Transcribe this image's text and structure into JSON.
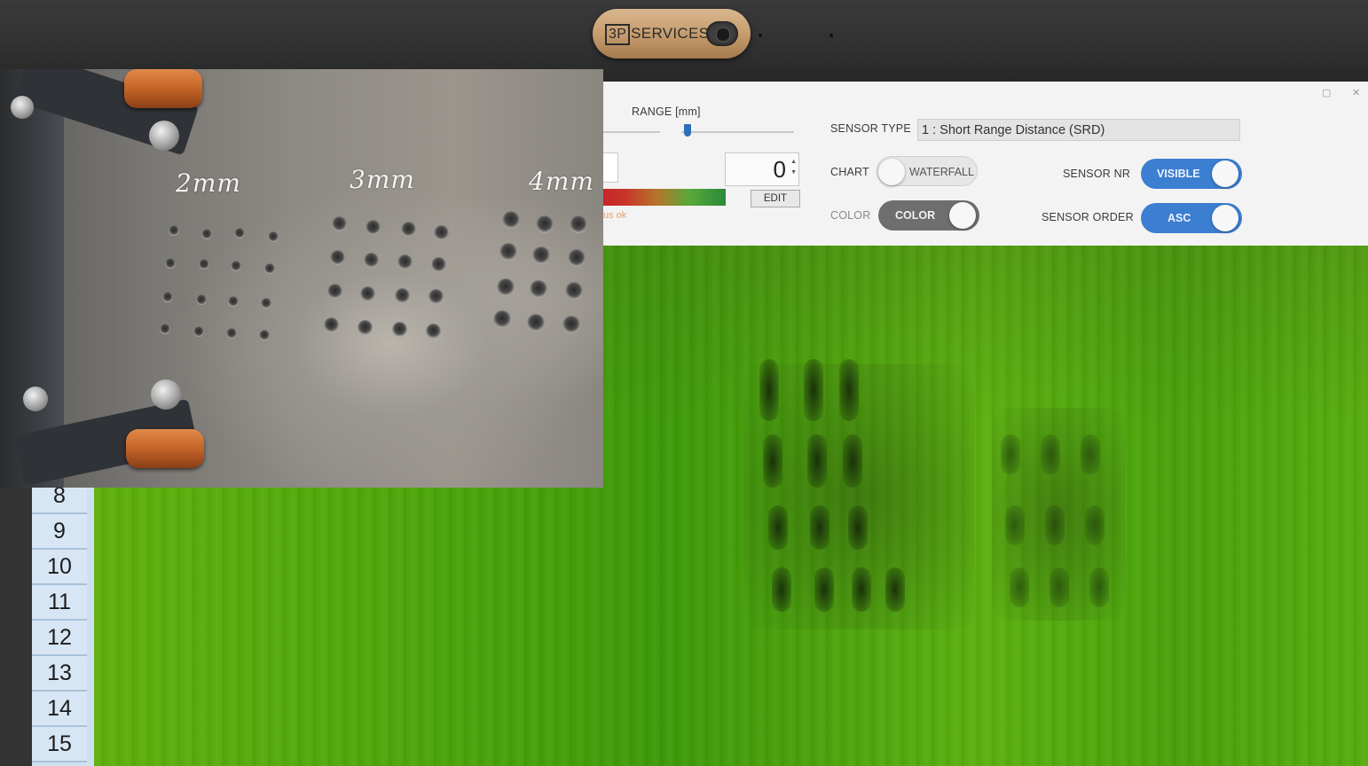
{
  "bezel": {
    "webcam_cover_brand_box": "3P",
    "webcam_cover_brand_text": "SERVICES"
  },
  "toolbar": {
    "range_label": "RANGE [mm]",
    "spin_value": "0",
    "edit_label": "EDIT",
    "status_partial": "us  ok",
    "sensor_type_label": "SENSOR TYPE",
    "sensor_type_value": "1 : Short Range Distance (SRD)",
    "chart_label": "CHART",
    "chart_toggle_text": "WATERFALL",
    "color_label": "COLOR",
    "color_toggle_text": "COLOR",
    "sensor_nr_label": "SENSOR NR",
    "sensor_nr_toggle_text": "VISIBLE",
    "sensor_order_label": "SENSOR ORDER",
    "sensor_order_toggle_text": "ASC",
    "window_restore_icon": "▢",
    "window_close_icon": "✕"
  },
  "rows": [
    "8",
    "9",
    "10",
    "11",
    "12",
    "13",
    "14",
    "15"
  ],
  "photo": {
    "labels": [
      "2mm",
      "3mm",
      "4mm"
    ]
  },
  "colors": {
    "toggle_blue": "#3c7ed0",
    "waterfall_green": "#4ea60c",
    "app_background": "#f3f3f3"
  }
}
